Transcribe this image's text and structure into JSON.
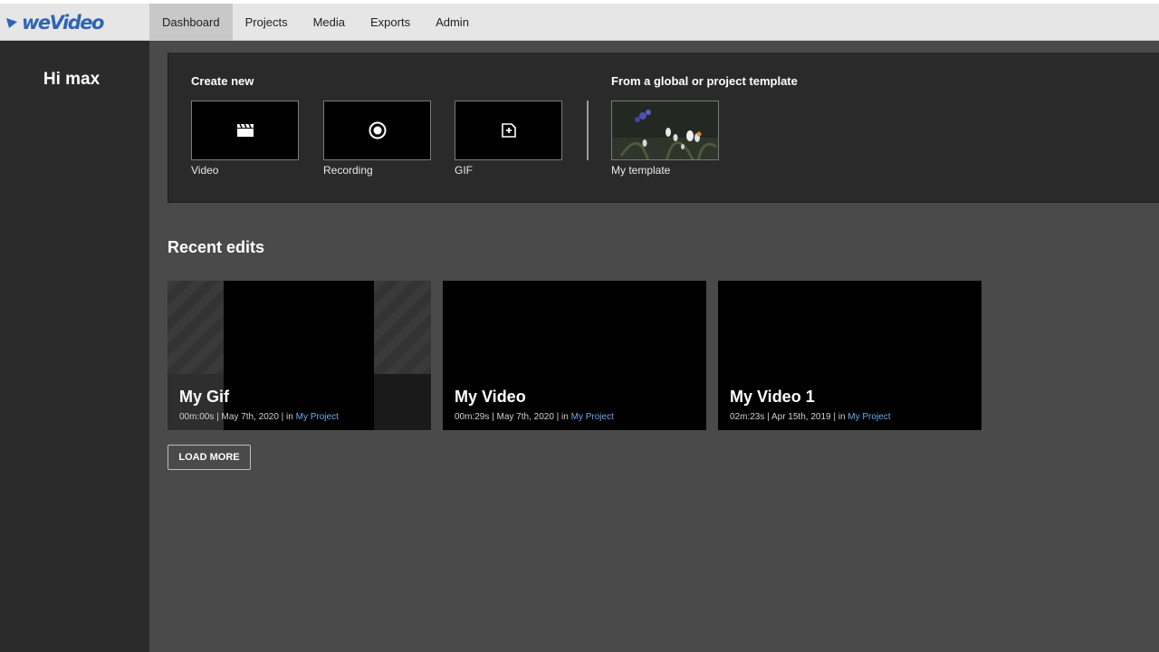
{
  "app": {
    "logo_text": "weVideo",
    "brand_color": "#2e65b5"
  },
  "nav": {
    "items": [
      {
        "label": "Dashboard",
        "active": true
      },
      {
        "label": "Projects"
      },
      {
        "label": "Media"
      },
      {
        "label": "Exports"
      },
      {
        "label": "Admin"
      }
    ]
  },
  "sidebar": {
    "greeting": "Hi max"
  },
  "create": {
    "heading": "Create new",
    "tiles": [
      {
        "label": "Video",
        "icon": "clapperboard-icon"
      },
      {
        "label": "Recording",
        "icon": "record-icon"
      },
      {
        "label": "GIF",
        "icon": "gif-add-icon"
      }
    ],
    "template_heading": "From a global or project template",
    "template_label": "My template"
  },
  "recent": {
    "title": "Recent edits",
    "cards": [
      {
        "title": "My Gif",
        "meta": "00m:00s | May 7th, 2020 | in ",
        "project": "My Project"
      },
      {
        "title": "My Video",
        "meta": "00m:29s | May 7th, 2020 | in ",
        "project": "My Project"
      },
      {
        "title": "My Video 1",
        "meta": "02m:23s | Apr 15th, 2019 | in ",
        "project": "My Project"
      }
    ],
    "load_more": "LOAD MORE"
  },
  "colors": {
    "link": "#6fa8ec",
    "panel": "#2a2a2a",
    "sidebar": "#2b2b2b",
    "content": "#4a4a4a"
  }
}
